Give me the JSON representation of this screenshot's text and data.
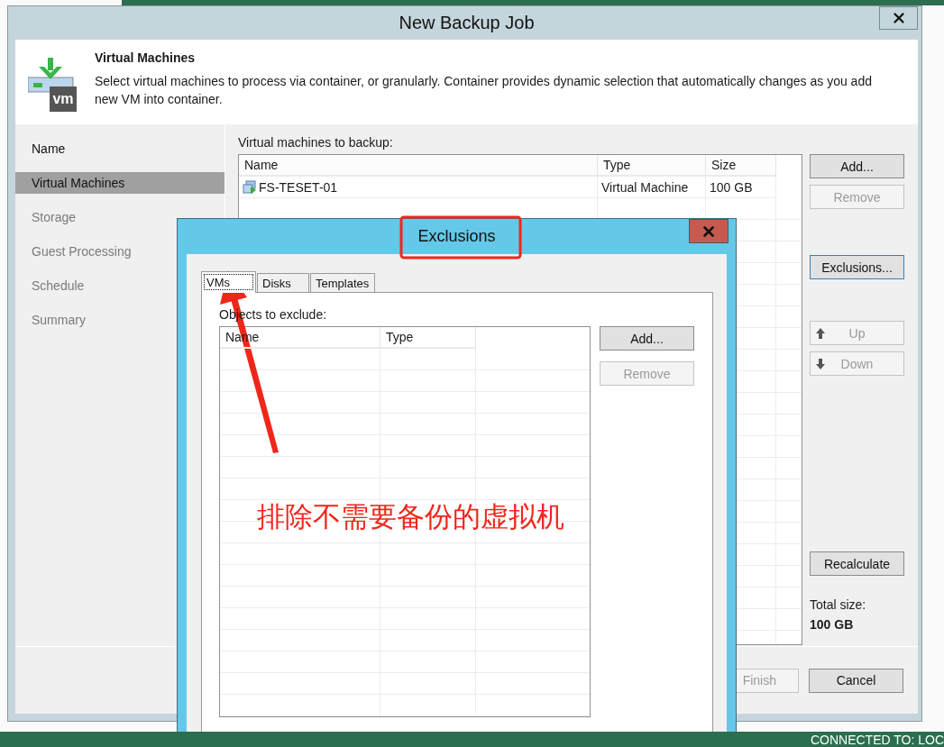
{
  "main_window": {
    "title": "New Backup Job"
  },
  "header": {
    "icon_label": "vm",
    "title": "Virtual Machines",
    "description": "Select virtual machines to process via container, or granularly. Container provides dynamic selection that automatically changes as you add new VM into container."
  },
  "nav": [
    {
      "label": "Name",
      "selected": false,
      "disabled": false
    },
    {
      "label": "Virtual Machines",
      "selected": true,
      "disabled": false
    },
    {
      "label": "Storage",
      "selected": false,
      "disabled": true
    },
    {
      "label": "Guest Processing",
      "selected": false,
      "disabled": true
    },
    {
      "label": "Schedule",
      "selected": false,
      "disabled": true
    },
    {
      "label": "Summary",
      "selected": false,
      "disabled": true
    }
  ],
  "vm_list": {
    "label": "Virtual machines to backup:",
    "columns": [
      "Name",
      "Type",
      "Size"
    ],
    "rows": [
      {
        "name": "FS-TESET-01",
        "type": "Virtual Machine",
        "size": "100 GB"
      }
    ]
  },
  "button_groups": [
    [
      {
        "label": "Add...",
        "kind": "plain",
        "disabled": false,
        "focused": false
      },
      {
        "label": "Remove",
        "kind": "plain",
        "disabled": true,
        "focused": false
      }
    ],
    [
      {
        "label": "Exclusions...",
        "kind": "plain",
        "disabled": false,
        "focused": true
      }
    ],
    [
      {
        "label": "Up",
        "kind": "up",
        "disabled": true,
        "focused": false
      },
      {
        "label": "Down",
        "kind": "down",
        "disabled": true,
        "focused": false
      }
    ],
    [
      {
        "label": "Recalculate",
        "kind": "plain",
        "disabled": false,
        "focused": false
      }
    ]
  ],
  "total": {
    "label": "Total size:",
    "value": "100 GB"
  },
  "footer_buttons": [
    {
      "label": "Finish",
      "disabled": true
    },
    {
      "label": "Cancel",
      "disabled": false
    }
  ],
  "exclusions": {
    "title": "Exclusions",
    "tabs": [
      {
        "label": "VMs",
        "selected": true
      },
      {
        "label": "Disks",
        "selected": false
      },
      {
        "label": "Templates",
        "selected": false
      }
    ],
    "label": "Objects to exclude:",
    "columns": [
      "Name",
      "Type"
    ],
    "buttons": [
      {
        "label": "Add...",
        "disabled": false
      },
      {
        "label": "Remove",
        "disabled": true
      }
    ]
  },
  "annotation": {
    "text": "排除不需要备份的虚拟机"
  },
  "status_bar": {
    "text": "CONNECTED TO: LOC"
  }
}
